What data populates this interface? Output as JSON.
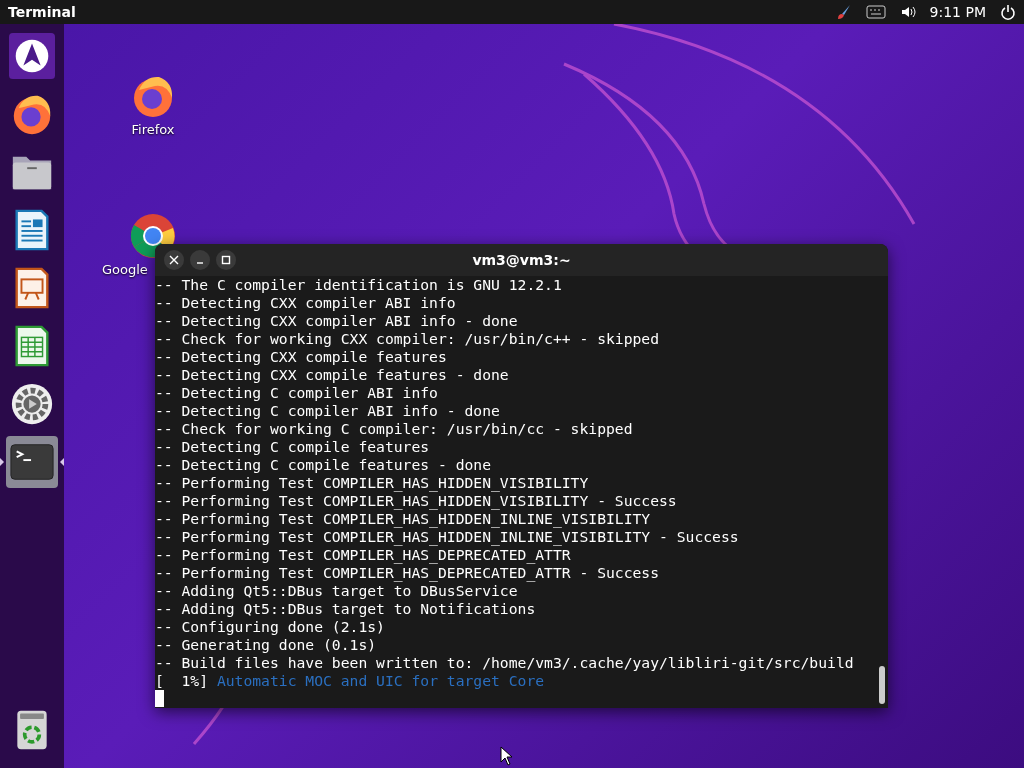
{
  "top_bar": {
    "app_menu": "Terminal",
    "clock": "9:11 PM"
  },
  "dock": {
    "items": [
      {
        "kind": "arch",
        "active": false
      },
      {
        "kind": "firefox",
        "active": false
      },
      {
        "kind": "files",
        "active": false
      },
      {
        "kind": "writer",
        "active": false
      },
      {
        "kind": "impress",
        "active": false
      },
      {
        "kind": "calc",
        "active": false
      },
      {
        "kind": "settings",
        "active": false
      },
      {
        "kind": "terminal",
        "active": true
      }
    ],
    "trash": {
      "kind": "trash"
    }
  },
  "desktop_icons": [
    {
      "kind": "firefox",
      "label": "Firefox"
    },
    {
      "kind": "chrome",
      "label": "Google"
    }
  ],
  "terminal": {
    "title": "vm3@vm3:~",
    "lines": [
      {
        "kind": "plain",
        "text": "-- The C compiler identification is GNU 12.2.1"
      },
      {
        "kind": "plain",
        "text": "-- Detecting CXX compiler ABI info"
      },
      {
        "kind": "plain",
        "text": "-- Detecting CXX compiler ABI info - done"
      },
      {
        "kind": "plain",
        "text": "-- Check for working CXX compiler: /usr/bin/c++ - skipped"
      },
      {
        "kind": "plain",
        "text": "-- Detecting CXX compile features"
      },
      {
        "kind": "plain",
        "text": "-- Detecting CXX compile features - done"
      },
      {
        "kind": "plain",
        "text": "-- Detecting C compiler ABI info"
      },
      {
        "kind": "plain",
        "text": "-- Detecting C compiler ABI info - done"
      },
      {
        "kind": "plain",
        "text": "-- Check for working C compiler: /usr/bin/cc - skipped"
      },
      {
        "kind": "plain",
        "text": "-- Detecting C compile features"
      },
      {
        "kind": "plain",
        "text": "-- Detecting C compile features - done"
      },
      {
        "kind": "plain",
        "text": "-- Performing Test COMPILER_HAS_HIDDEN_VISIBILITY"
      },
      {
        "kind": "plain",
        "text": "-- Performing Test COMPILER_HAS_HIDDEN_VISIBILITY - Success"
      },
      {
        "kind": "plain",
        "text": "-- Performing Test COMPILER_HAS_HIDDEN_INLINE_VISIBILITY"
      },
      {
        "kind": "plain",
        "text": "-- Performing Test COMPILER_HAS_HIDDEN_INLINE_VISIBILITY - Success"
      },
      {
        "kind": "plain",
        "text": "-- Performing Test COMPILER_HAS_DEPRECATED_ATTR"
      },
      {
        "kind": "plain",
        "text": "-- Performing Test COMPILER_HAS_DEPRECATED_ATTR - Success"
      },
      {
        "kind": "plain",
        "text": "-- Adding Qt5::DBus target to DBusService"
      },
      {
        "kind": "plain",
        "text": "-- Adding Qt5::DBus target to Notifications"
      },
      {
        "kind": "plain",
        "text": "-- Configuring done (2.1s)"
      },
      {
        "kind": "plain",
        "text": "-- Generating done (0.1s)"
      },
      {
        "kind": "plain",
        "text": "-- Build files have been written to: /home/vm3/.cache/yay/libliri-git/src/build"
      },
      {
        "kind": "progress",
        "prefix": "[  1%]",
        "text": "Automatic MOC and UIC for target Core"
      }
    ]
  }
}
